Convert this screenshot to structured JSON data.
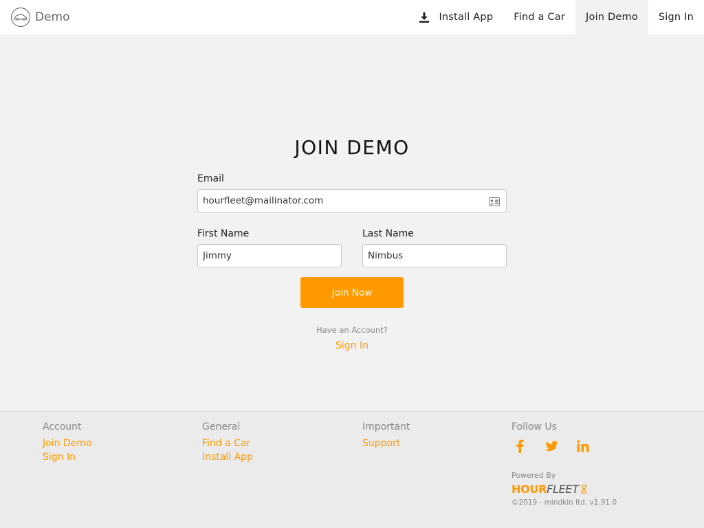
{
  "header": {
    "brand": "Demo",
    "nav": {
      "install_app": "Install App",
      "find_car": "Find a Car",
      "join_demo": "Join Demo",
      "sign_in": "Sign In"
    }
  },
  "form": {
    "title": "JOIN DEMO",
    "email_label": "Email",
    "email_value": "hourfleet@mailinator.com",
    "first_name_label": "First Name",
    "first_name_value": "Jimmy",
    "last_name_label": "Last Name",
    "last_name_value": "Nimbus",
    "submit_label": "Join Now",
    "have_account": "Have an Account?",
    "sign_in_link": "Sign In"
  },
  "footer": {
    "account": {
      "heading": "Account",
      "links": [
        "Join Demo",
        "Sign In"
      ]
    },
    "general": {
      "heading": "General",
      "links": [
        "Find a Car",
        "Install App"
      ]
    },
    "important": {
      "heading": "Important",
      "links": [
        "Support"
      ]
    },
    "follow": {
      "heading": "Follow Us",
      "icons": [
        "facebook-icon",
        "twitter-icon",
        "linkedin-icon"
      ]
    },
    "powered_by": "Powered By",
    "logo_hour": "HOUR",
    "logo_fleet": "FLEET",
    "copyright": "©2019 - mindkin ltd. v1.91.0"
  },
  "colors": {
    "accent": "#ff9900",
    "page_bg": "#f2f2f2",
    "header_bg": "#ffffff",
    "footer_bg": "#ebebeb",
    "muted_text": "#888888"
  }
}
